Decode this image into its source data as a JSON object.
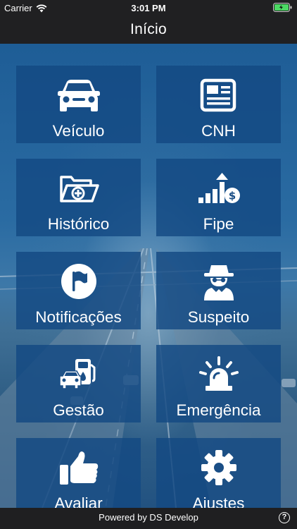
{
  "status_bar": {
    "carrier": "Carrier",
    "time": "3:01 PM"
  },
  "nav": {
    "title": "Início"
  },
  "tiles": [
    {
      "label": "Veículo",
      "icon": "car-icon"
    },
    {
      "label": "CNH",
      "icon": "newspaper-icon"
    },
    {
      "label": "Histórico",
      "icon": "folder-add-icon"
    },
    {
      "label": "Fipe",
      "icon": "chart-dollar-icon"
    },
    {
      "label": "Notificações",
      "icon": "flag-icon"
    },
    {
      "label": "Suspeito",
      "icon": "spy-icon"
    },
    {
      "label": "Gestão",
      "icon": "car-fuel-icon"
    },
    {
      "label": "Emergência",
      "icon": "siren-icon"
    },
    {
      "label": "Avaliar",
      "icon": "thumbs-up-icon"
    },
    {
      "label": "Ajustes",
      "icon": "gear-icon"
    }
  ],
  "footer": {
    "text": "Powered by DS Develop",
    "help": "?"
  }
}
